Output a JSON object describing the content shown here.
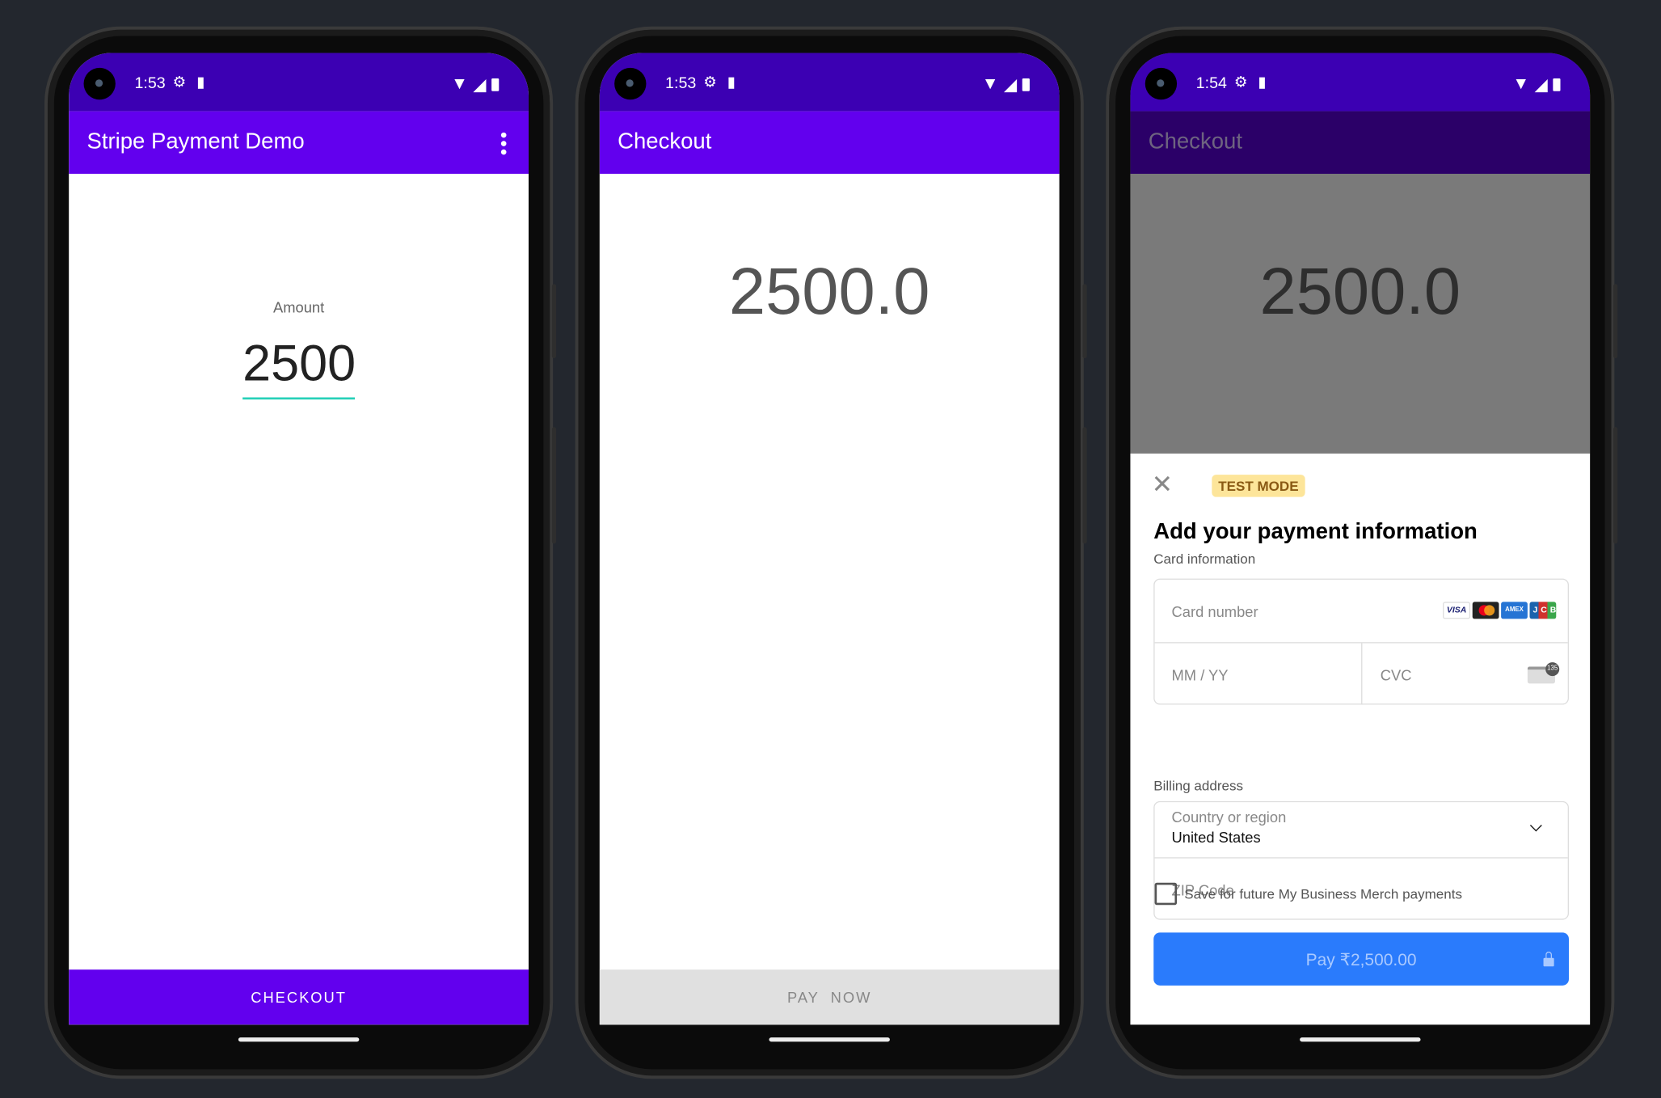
{
  "phones": [
    {
      "status": {
        "time": "1:53"
      },
      "appbar": {
        "title": "Stripe Payment Demo"
      },
      "amount_label": "Amount",
      "amount_value": "2500",
      "bottom_button": "CHECKOUT"
    },
    {
      "status": {
        "time": "1:53"
      },
      "appbar": {
        "title": "Checkout"
      },
      "amount_display": "2500.0",
      "bottom_button": "PAY  NOW"
    },
    {
      "status": {
        "time": "1:54"
      },
      "appbar": {
        "title": "Checkout"
      },
      "amount_display": "2500.0",
      "payment_sheet": {
        "badge": "TEST MODE",
        "heading": "Add your payment information",
        "card_section_label": "Card information",
        "card_number_placeholder": "Card number",
        "expiry_placeholder": "MM / YY",
        "cvc_placeholder": "CVC",
        "card_brands": [
          "VISA",
          "Mastercard",
          "AMEX",
          "JCB"
        ],
        "cvc_icon_text": "135",
        "billing_label": "Billing address",
        "country_label": "Country or region",
        "country_value": "United States",
        "zip_placeholder": "ZIP Code",
        "save_checkbox_label": "Save for future My Business Merch payments",
        "save_checked": false,
        "pay_button": "Pay ₹2,500.00"
      }
    }
  ],
  "colors": {
    "primary": "#6200ee",
    "status_bar": "#3c00b3",
    "accent": "#26d0b8",
    "pay_button": "#2a7bfc",
    "badge_bg": "#fde59a"
  }
}
